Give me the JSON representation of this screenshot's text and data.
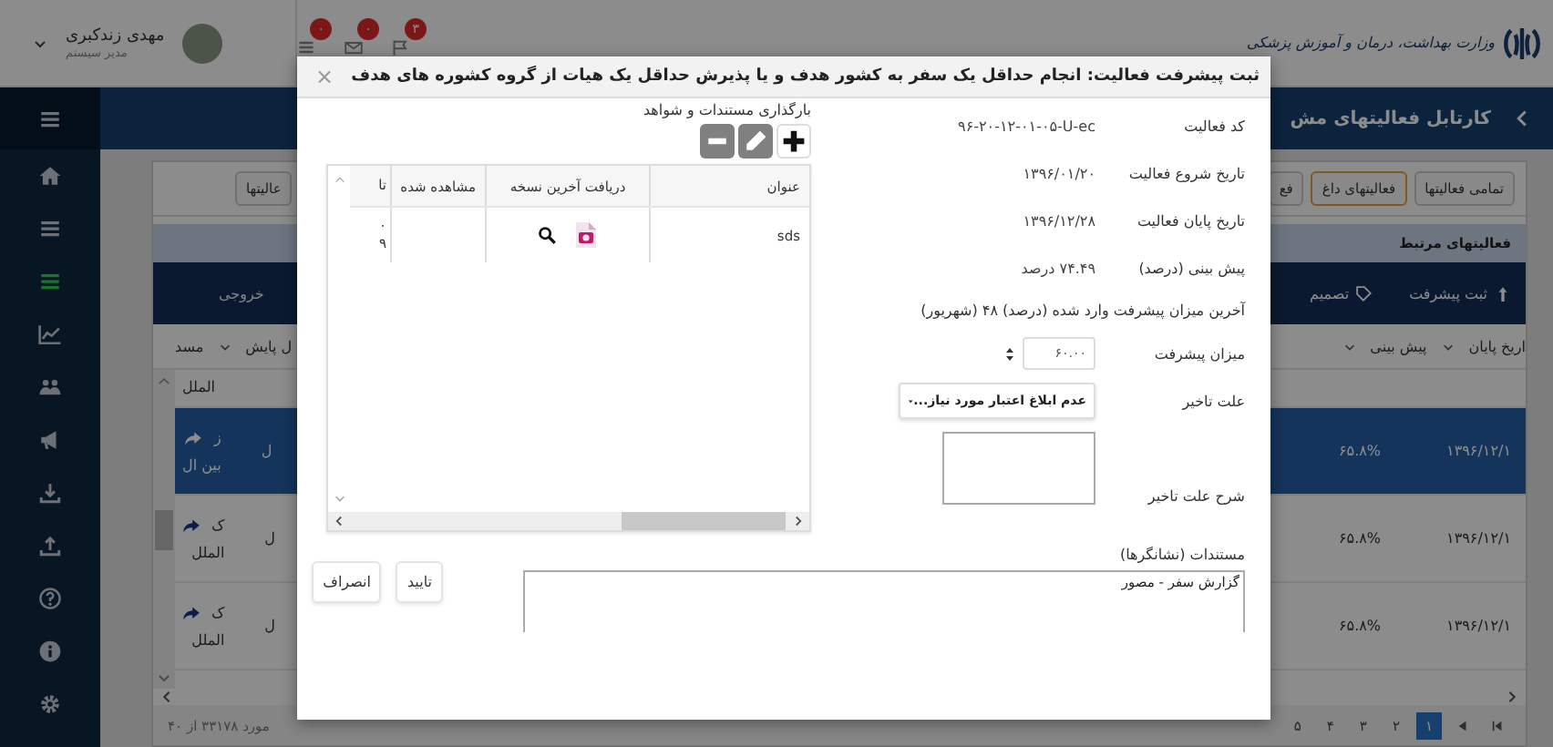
{
  "header": {
    "logo_text": "وزارت بهداشت، درمان و آموزش پزشکی",
    "notifications": [
      {
        "kind": "flag",
        "count": "۳"
      },
      {
        "kind": "mail",
        "count": "۰"
      },
      {
        "kind": "list",
        "count": "۰"
      }
    ],
    "user": {
      "name": "مهدی زندکبری",
      "role": "مدیر سیستم"
    }
  },
  "sidebar": {
    "items": [
      {
        "kind": "home",
        "selected": false
      },
      {
        "kind": "list",
        "selected": false
      },
      {
        "kind": "list",
        "selected": true
      },
      {
        "kind": "chart",
        "selected": false
      },
      {
        "kind": "users",
        "selected": false
      },
      {
        "kind": "megaphone",
        "selected": false
      },
      {
        "kind": "download",
        "selected": false
      },
      {
        "kind": "upload",
        "selected": false
      },
      {
        "kind": "help",
        "selected": false
      },
      {
        "kind": "info",
        "selected": false
      },
      {
        "kind": "gear",
        "selected": false
      }
    ]
  },
  "page": {
    "title": "کارتابل فعالیتهای مش",
    "tabs": [
      {
        "label": "تمامی فعالیتها",
        "selected": false
      },
      {
        "label": "فعالیتهای داغ",
        "selected": true
      },
      {
        "label": "فع",
        "selected": false
      },
      {
        "label": "عالیتها",
        "selected": false
      }
    ],
    "section_title": "فعالیتهای مرتبط",
    "toolbar": {
      "actions": [
        "ثبت پیشرفت",
        "تصمیم"
      ],
      "export": "خروجی"
    },
    "columns_right": [
      "اریخ پایان",
      "پیش بینی"
    ],
    "columns_left": [
      "ل پایش",
      "مسد"
    ],
    "rows": [
      {
        "selected": false,
        "forwarded": false,
        "name_bottom": "الملل"
      },
      {
        "selected": true,
        "forwarded": true,
        "name_top": "ز",
        "name_bottom": "بین ال",
        "status": "ل",
        "forecast": "۶۵.۸%",
        "end_date": "۱۳۹۶/۱۲/۱"
      },
      {
        "selected": false,
        "forwarded": true,
        "name_top": "ک",
        "name_bottom": "الملل",
        "status": "ل",
        "forecast": "۶۵.۸%",
        "end_date": "۱۳۹۶/۱۲/۱"
      },
      {
        "selected": false,
        "forwarded": true,
        "name_top": "ک",
        "name_bottom": "الملل",
        "status": "ل",
        "forecast": "۶۵.۸%",
        "end_date": "۱۳۹۶/۱۲/۱"
      }
    ],
    "record_count": "مورد ۳۳۱۷۸ از ۴۰",
    "pages": [
      {
        "label": "۱",
        "selected": true
      },
      {
        "label": "۲",
        "selected": false
      },
      {
        "label": "۳",
        "selected": false
      },
      {
        "label": "۴",
        "selected": false
      },
      {
        "label": "۵",
        "selected": false
      }
    ]
  },
  "dialog": {
    "title": "ثبت پیشرفت فعالیت: انجام حداقل یک سفر به کشور هدف و یا پذیرش حداقل یک هیات از گروه کشوره های هدف",
    "close": "×",
    "info": [
      {
        "label": "کد فعالیت",
        "value": "۹۶-۲۰-۱۲-۰۱-۰۵-U-ec"
      },
      {
        "label": "تاریخ شروع فعالیت",
        "value": "۱۳۹۶/۰۱/۲۰"
      },
      {
        "label": "تاریخ پایان فعالیت",
        "value": "۱۳۹۶/۱۲/۲۸"
      },
      {
        "label": "پیش بینی (درصد)",
        "value": "۷۴.۴۹ درصد"
      }
    ],
    "last_progress": "آخرین میزان پیشرفت وارد شده (درصد) ۴۸ (شهریور)",
    "progress": {
      "label": "میزان پیشرفت",
      "value": "۶۰.۰۰"
    },
    "delay_reason": {
      "label": "علت تاخیر",
      "value": "عدم ابلاغ اعتبار مورد نیاز..."
    },
    "delay_description": {
      "label": "شرح علت تاخیر"
    },
    "documents_field": {
      "label": "مستندات (نشانگرها)",
      "value": "گزارش سفر - مصور"
    },
    "uploads": {
      "title": "بارگذاری مستندات و شواهد",
      "columns": [
        "عنوان",
        "دریافت آخرین نسخه",
        "مشاهده شده",
        "تا"
      ],
      "rows": [
        {
          "title": "sds",
          "seen_to": "۰ ۹"
        }
      ]
    },
    "buttons": [
      "تایید",
      "انصراف"
    ]
  }
}
